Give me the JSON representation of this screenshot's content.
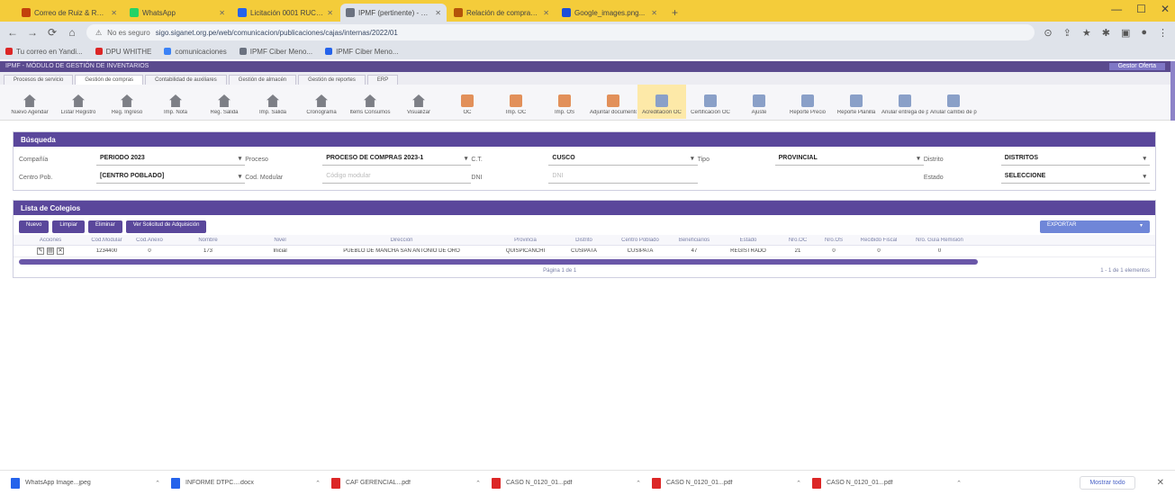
{
  "browser": {
    "tabs": [
      {
        "title": "Correo de Ruiz & Ruiz Sr...",
        "fav": "#c2410c",
        "active": false
      },
      {
        "title": "WhatsApp",
        "fav": "#25d366",
        "active": false
      },
      {
        "title": "Licitación 0001 RUCOMAST...",
        "fav": "#2563eb",
        "active": false
      },
      {
        "title": "IPMF (pertinente) - Window...",
        "fav": "#6b7280",
        "active": true
      },
      {
        "title": "Relación de comprador...",
        "fav": "#b45309",
        "active": false
      },
      {
        "title": "Google_images.png...",
        "fav": "#1d4ed8",
        "active": false
      }
    ],
    "new_tab": "+",
    "url_prefix": "No es seguro",
    "url": "sigo.siganet.org.pe/web/comunicacion/publicaciones/cajas/internas/2022/01",
    "bookmarks": [
      {
        "label": "Tu correo en Yandi...",
        "color": "#dc2626"
      },
      {
        "label": "DPU WHITHE",
        "color": "#dc2626"
      },
      {
        "label": "comunicaciones",
        "color": "#3b82f6"
      },
      {
        "label": "IPMF Ciber Meno...",
        "color": "#6b7280"
      },
      {
        "label": "IPMF Ciber Meno...",
        "color": "#2563eb"
      }
    ]
  },
  "app": {
    "header_title": "IPMF - MÓDULO DE GESTIÓN DE INVENTARIOS",
    "user": "Gestor Oferta",
    "menu_tabs": [
      "Procesos de servicio",
      "Gestión de compras",
      "Contabilidad de auxiliares",
      "Gestión de almacén",
      "Gestión de reportes",
      "ERP"
    ],
    "active_menu": 1,
    "toolbar": [
      {
        "label": "Nuevo Agendar",
        "icon": "house"
      },
      {
        "label": "Listar Registro",
        "icon": "house"
      },
      {
        "label": "Reg. Ingreso",
        "icon": "house"
      },
      {
        "label": "Imp. Nota",
        "icon": "house"
      },
      {
        "label": "Reg. Salida",
        "icon": "house"
      },
      {
        "label": "Imp. Salida",
        "icon": "house"
      },
      {
        "label": "Cronograma",
        "icon": "house"
      },
      {
        "label": "Items Consumos",
        "icon": "house"
      },
      {
        "label": "Visualizar",
        "icon": "house"
      },
      {
        "label": "OC",
        "icon": "box"
      },
      {
        "label": "Imp. OC",
        "icon": "box"
      },
      {
        "label": "Imp. OS",
        "icon": "box"
      },
      {
        "label": "Adjuntar documento",
        "icon": "box"
      },
      {
        "label": "Acreditación OC",
        "icon": "doc",
        "selected": true
      },
      {
        "label": "Certificación OC",
        "icon": "doc"
      },
      {
        "label": "Ajuste",
        "icon": "doc"
      },
      {
        "label": "Reporte Precio",
        "icon": "doc"
      },
      {
        "label": "Reporte Planilla",
        "icon": "doc"
      },
      {
        "label": "Anular entrega de producto",
        "icon": "doc"
      },
      {
        "label": "Anular cambio de producto",
        "icon": "doc"
      }
    ]
  },
  "search": {
    "title": "Búsqueda",
    "rows": [
      [
        {
          "label": "Compañía",
          "value": "PERIODO 2023",
          "select": true
        },
        {
          "label": "Proceso",
          "value": "PROCESO DE COMPRAS 2023-1",
          "select": true
        },
        {
          "label": "C.T.",
          "value": "CUSCO",
          "select": true
        },
        {
          "label": "Tipo",
          "value": "PROVINCIAL",
          "select": true
        },
        {
          "label": "Distrito",
          "value": "DISTRITOS",
          "select": true
        }
      ],
      [
        {
          "label": "Centro Pob.",
          "value": "[CENTRO POBLADO]",
          "select": true
        },
        {
          "label": "Cod. Modular",
          "value": "Código modular",
          "placeholder": true
        },
        {
          "label": "DNI",
          "value": "DNI",
          "placeholder": true
        },
        {
          "label": "",
          "value": "",
          "hidden": true
        },
        {
          "label": "Estado",
          "value": "SELECCIONE",
          "select": true
        }
      ]
    ]
  },
  "results": {
    "title": "Lista de Colegios",
    "buttons": [
      "Nuevo",
      "Limpiar",
      "Eliminar",
      "Ver Solicitud de Adquisición"
    ],
    "export_label": "EXPORTAR",
    "columns": [
      "Acciones",
      "Cod.Modular",
      "Cod.Anexo",
      "Nombre",
      "Nivel",
      "Dirección",
      "Provincia",
      "Distrito",
      "Centro Poblado",
      "Beneficiarios",
      "Estado",
      "Nro.OC",
      "Nro.OS",
      "Recibido Fiscal",
      "Nro. Guía Remisión"
    ],
    "rows": [
      [
        "",
        "1234400",
        "0",
        "173",
        "Inicial",
        "PUEBLO DE MANCHA SAN ANTONIO DE ORO",
        "QUISPICANCHI",
        "CUSIPATA",
        "CUSIPATA",
        "47",
        "REGISTRADO",
        "21",
        "0",
        "0",
        "0"
      ]
    ],
    "pager_mid": "Página 1 de 1",
    "pager_right": "1 - 1 de 1 elementos"
  },
  "downloads": {
    "items": [
      {
        "name": "WhatsApp Image...jpeg",
        "color": "#2563eb"
      },
      {
        "name": "INFORME DTPC....docx",
        "color": "#2563eb"
      },
      {
        "name": "CAF GERENCIAL...pdf",
        "color": "#dc2626"
      },
      {
        "name": "CASO N_0120_01...pdf",
        "color": "#dc2626"
      },
      {
        "name": "CASO N_0120_01...pdf",
        "color": "#dc2626"
      },
      {
        "name": "CASO N_0120_01...pdf",
        "color": "#dc2626"
      }
    ],
    "show_all": "Mostrar todo"
  }
}
